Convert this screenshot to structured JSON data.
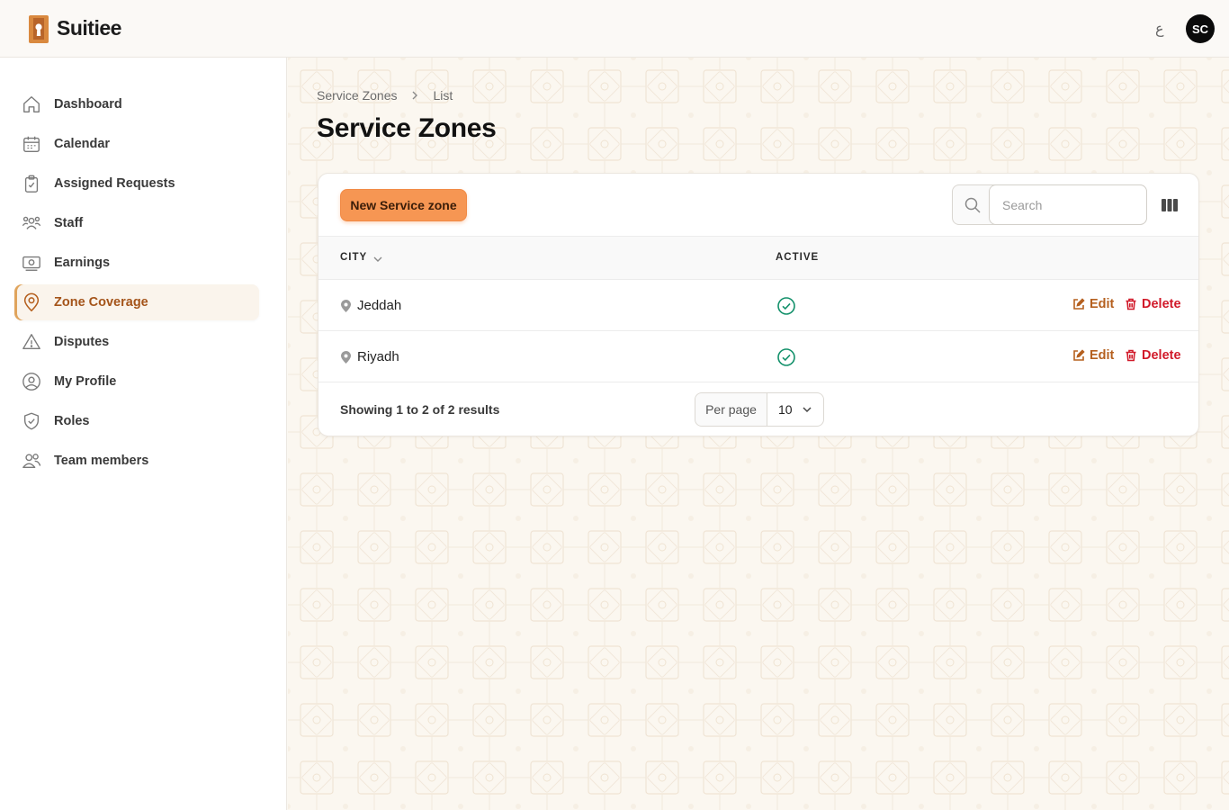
{
  "app": {
    "name": "Suitiee",
    "lang_toggle": "ع",
    "user_initials": "SC"
  },
  "sidebar": {
    "items": [
      {
        "label": "Dashboard",
        "icon": "home-icon"
      },
      {
        "label": "Calendar",
        "icon": "calendar-icon"
      },
      {
        "label": "Assigned Requests",
        "icon": "clipboard-check-icon"
      },
      {
        "label": "Staff",
        "icon": "users-group-icon"
      },
      {
        "label": "Earnings",
        "icon": "banknote-icon"
      },
      {
        "label": "Zone Coverage",
        "icon": "map-pin-icon",
        "active": true
      },
      {
        "label": "Disputes",
        "icon": "warning-triangle-icon"
      },
      {
        "label": "My Profile",
        "icon": "user-circle-icon"
      },
      {
        "label": "Roles",
        "icon": "shield-check-icon"
      },
      {
        "label": "Team members",
        "icon": "users-icon"
      }
    ]
  },
  "breadcrumb": {
    "parent": "Service Zones",
    "current": "List"
  },
  "page": {
    "title": "Service Zones"
  },
  "toolbar": {
    "new_button": "New Service zone",
    "search_placeholder": "Search"
  },
  "table": {
    "columns": {
      "city": "CITY",
      "active": "ACTIVE"
    },
    "rows": [
      {
        "city": "Jeddah",
        "active": true,
        "edit": "Edit",
        "delete": "Delete"
      },
      {
        "city": "Riyadh",
        "active": true,
        "edit": "Edit",
        "delete": "Delete"
      }
    ]
  },
  "pagination": {
    "summary": "Showing 1 to 2 of 2 results",
    "per_page_label": "Per page",
    "per_page_value": "10"
  },
  "colors": {
    "accent": "#f69653",
    "active_nav_text": "#a4541a",
    "edit": "#b5601f",
    "delete": "#d11a2a",
    "success": "#14916b"
  }
}
